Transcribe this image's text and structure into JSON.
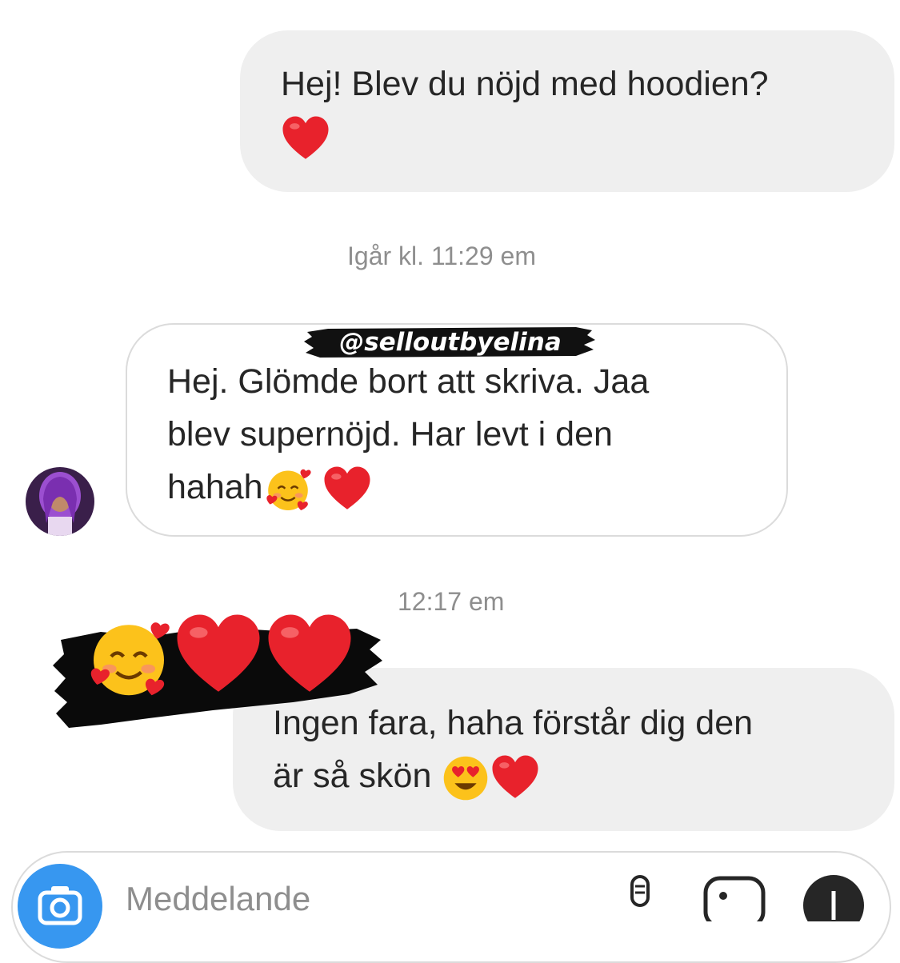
{
  "messages": [
    {
      "lines": [
        "Hej! Blev du nöjd med hoodien?"
      ],
      "emoji_line": "❤️"
    },
    {
      "lines": [
        "Hej. Glömde bort att skriva. Jaa",
        "blev supernöjd. Har levt i den",
        "hahah"
      ]
    },
    {
      "lines": [
        "Ingen fara, haha förstår dig den",
        "är så skön"
      ]
    }
  ],
  "timestamps": [
    "Igår kl. 11:29 em",
    "12:17 em"
  ],
  "watermark": "@selloutbyelina",
  "reaction_icons": [
    "smiling-face-with-hearts-icon",
    "red-heart-icon",
    "red-heart-icon"
  ],
  "input": {
    "placeholder": "Meddelande"
  },
  "colors": {
    "sent_bubble": "#efefef",
    "heart": "#e8222c",
    "camera": "#3797f0",
    "timestamp": "#8e8e8e"
  }
}
